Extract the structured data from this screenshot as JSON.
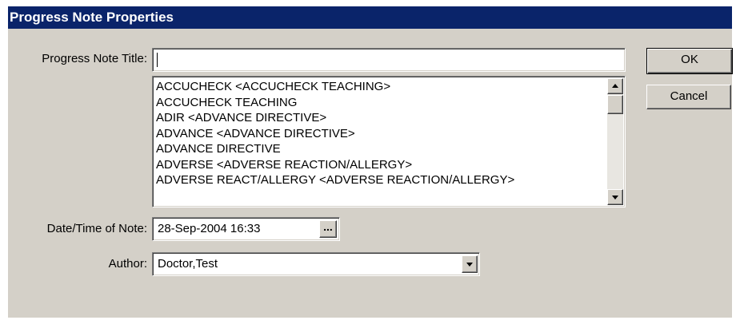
{
  "window": {
    "title": "Progress Note Properties"
  },
  "title_field": {
    "label": "Progress Note Title:",
    "value": ""
  },
  "title_list": {
    "items": [
      "ACCUCHECK  <ACCUCHECK TEACHING>",
      "ACCUCHECK TEACHING",
      "ADIR <ADVANCE DIRECTIVE>",
      "ADVANCE  <ADVANCE DIRECTIVE>",
      "ADVANCE DIRECTIVE",
      "ADVERSE  <ADVERSE REACTION/ALLERGY>",
      "ADVERSE REACT/ALLERGY <ADVERSE REACTION/ALLERGY>"
    ]
  },
  "buttons": {
    "ok": "OK",
    "cancel": "Cancel",
    "ellipsis": "..."
  },
  "date_field": {
    "label": "Date/Time of Note:",
    "value": "28-Sep-2004 16:33"
  },
  "author_field": {
    "label": "Author:",
    "value": "Doctor,Test"
  },
  "icons": {
    "scroll_up": "up-arrow-icon",
    "scroll_down": "down-arrow-icon",
    "combo_dropdown": "chevron-down-icon"
  },
  "colors": {
    "titlebar": "#0a246a",
    "dialog_bg": "#d4d0c8",
    "field_bg": "#ffffff"
  }
}
